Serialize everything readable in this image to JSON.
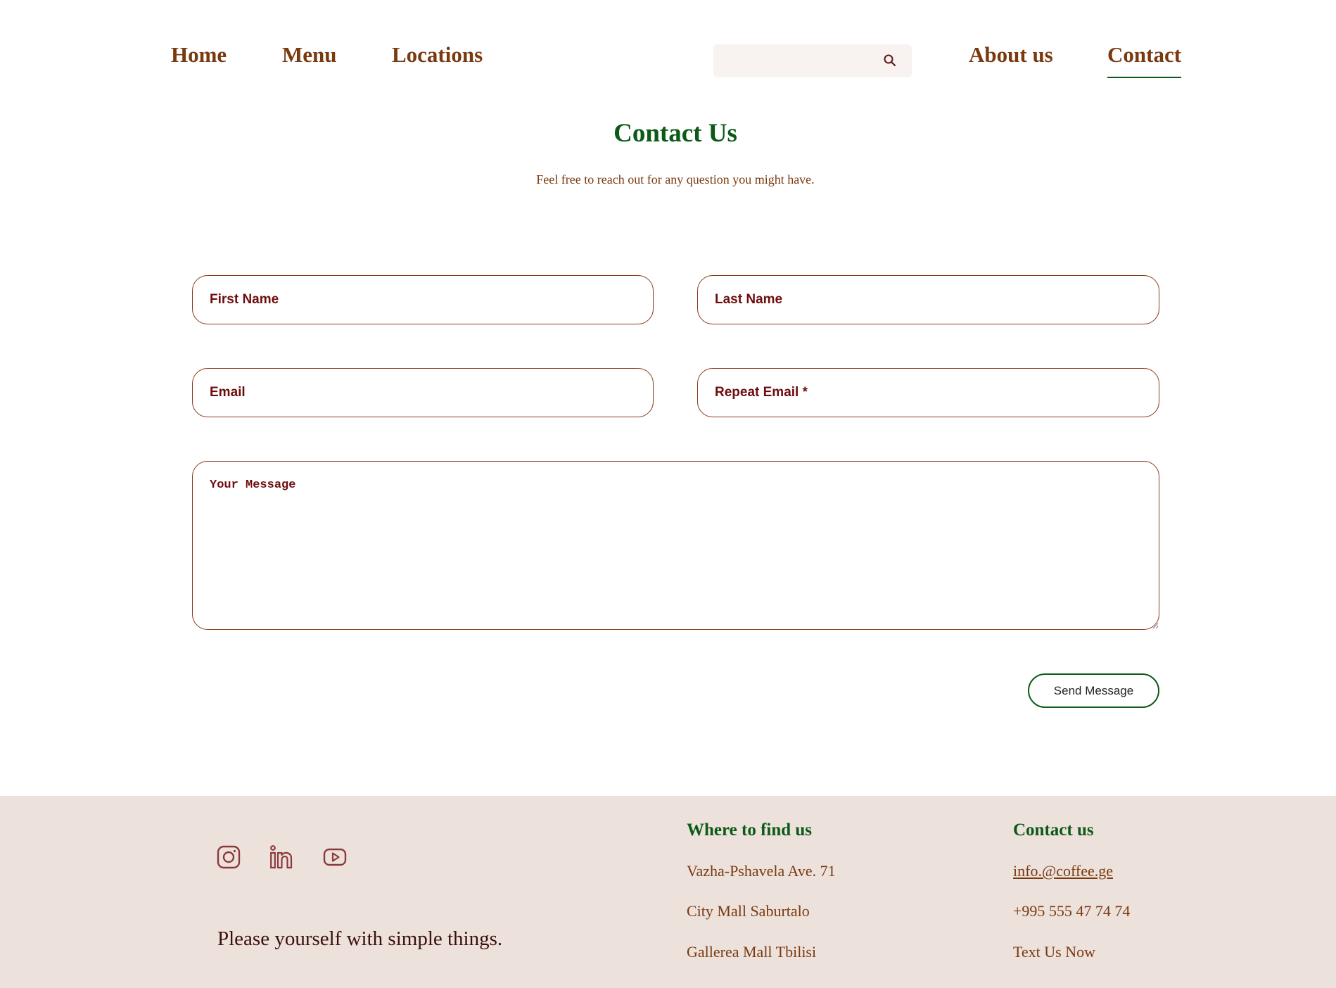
{
  "nav": {
    "home": "Home",
    "menu": "Menu",
    "locations": "Locations",
    "about": "About us",
    "contact": "Contact",
    "search_placeholder": ""
  },
  "header": {
    "title": "Contact Us",
    "subtitle": "Feel free to reach out for any question you might have."
  },
  "form": {
    "first_name_placeholder": "First Name",
    "last_name_placeholder": "Last Name",
    "email_placeholder": "Email",
    "repeat_email_placeholder": "Repeat Email *",
    "message_placeholder": "Your Message",
    "send_label": "Send Message"
  },
  "footer": {
    "social": [
      "instagram-icon",
      "linkedin-icon",
      "youtube-icon"
    ],
    "tagline": "Please yourself with simple things.",
    "where": {
      "title": "Where to find us",
      "items": [
        "Vazha-Pshavela Ave. 71",
        "City Mall Saburtalo",
        "Gallerea Mall Tbilisi"
      ]
    },
    "contact": {
      "title": "Contact us",
      "email": "info.@coffee.ge",
      "phone": "+995 555 47 74 74",
      "text": "Text Us Now"
    }
  },
  "colors": {
    "nav_text": "#7a3a10",
    "heading_green": "#0b5a17",
    "field_border": "#8b3a1a",
    "field_text": "#6e0d0d",
    "footer_bg": "#ede1dc"
  }
}
